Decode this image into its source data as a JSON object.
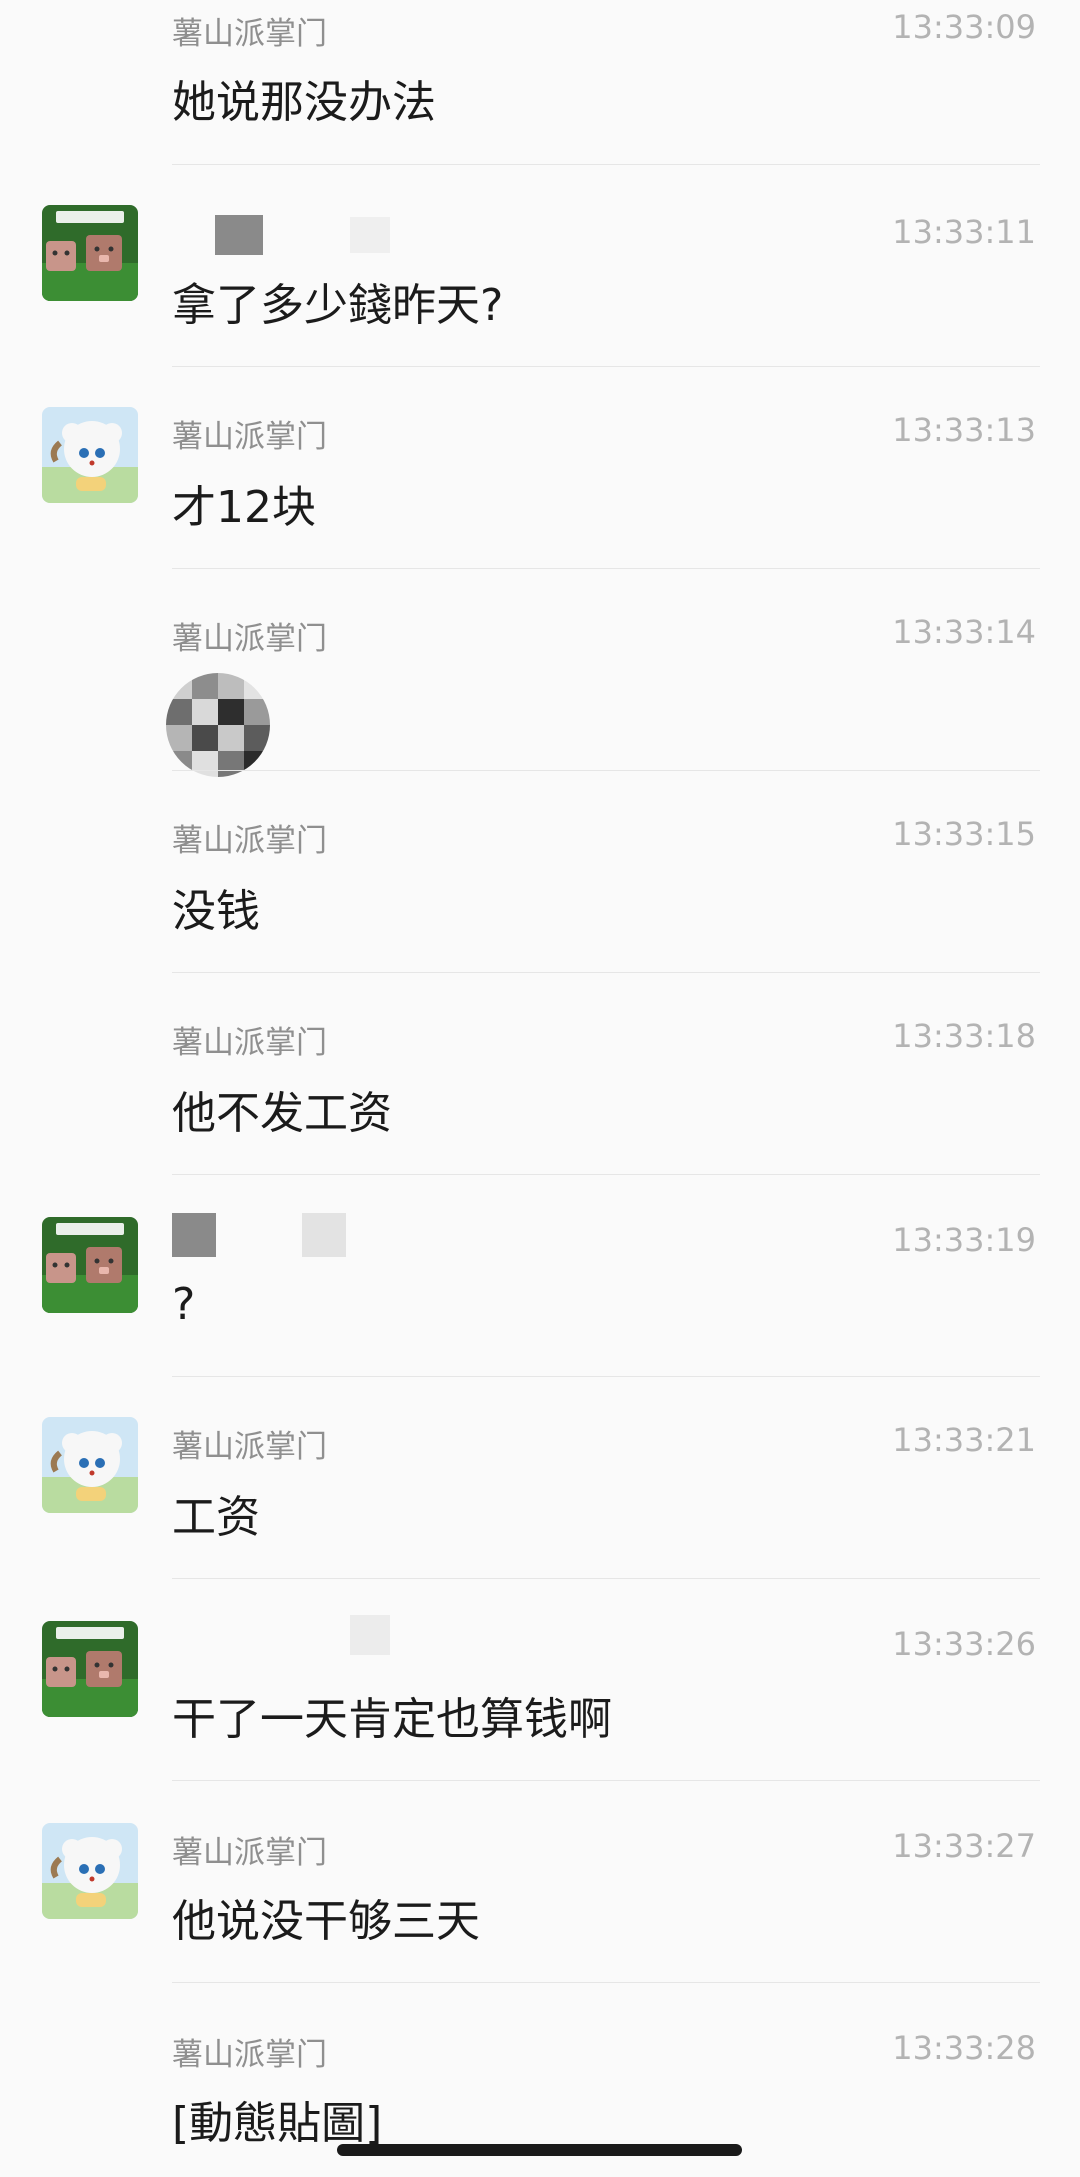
{
  "messages": [
    {
      "sender": "薯山派掌门",
      "time": "13:33:09",
      "text": "她说那没办法",
      "avatar": "none"
    },
    {
      "sender": "",
      "time": "13:33:11",
      "text": "拿了多少錢昨天?",
      "avatar": "pig-avatar"
    },
    {
      "sender": "薯山派掌门",
      "time": "13:33:13",
      "text": "才12块",
      "avatar": "sheep-avatar"
    },
    {
      "sender": "薯山派掌门",
      "time": "13:33:14",
      "text": "",
      "avatar": "none"
    },
    {
      "sender": "薯山派掌门",
      "time": "13:33:15",
      "text": "没钱",
      "avatar": "none"
    },
    {
      "sender": "薯山派掌门",
      "time": "13:33:18",
      "text": "他不发工资",
      "avatar": "none"
    },
    {
      "sender": "",
      "time": "13:33:19",
      "text": "?",
      "avatar": "pig-avatar"
    },
    {
      "sender": "薯山派掌门",
      "time": "13:33:21",
      "text": "工资",
      "avatar": "sheep-avatar"
    },
    {
      "sender": "",
      "time": "13:33:26",
      "text": "干了一天肯定也算钱啊",
      "avatar": "pig-avatar"
    },
    {
      "sender": "薯山派掌门",
      "time": "13:33:27",
      "text": "他说没干够三天",
      "avatar": "sheep-avatar"
    },
    {
      "sender": "薯山派掌门",
      "time": "13:33:28",
      "text": "[動態貼圖]",
      "avatar": "none"
    }
  ],
  "colors": {
    "background": "#fafafa",
    "sender": "#8f8f8f",
    "time": "#b3b3b3",
    "text": "#1b1b1b",
    "divider": "#e6e6e6"
  }
}
